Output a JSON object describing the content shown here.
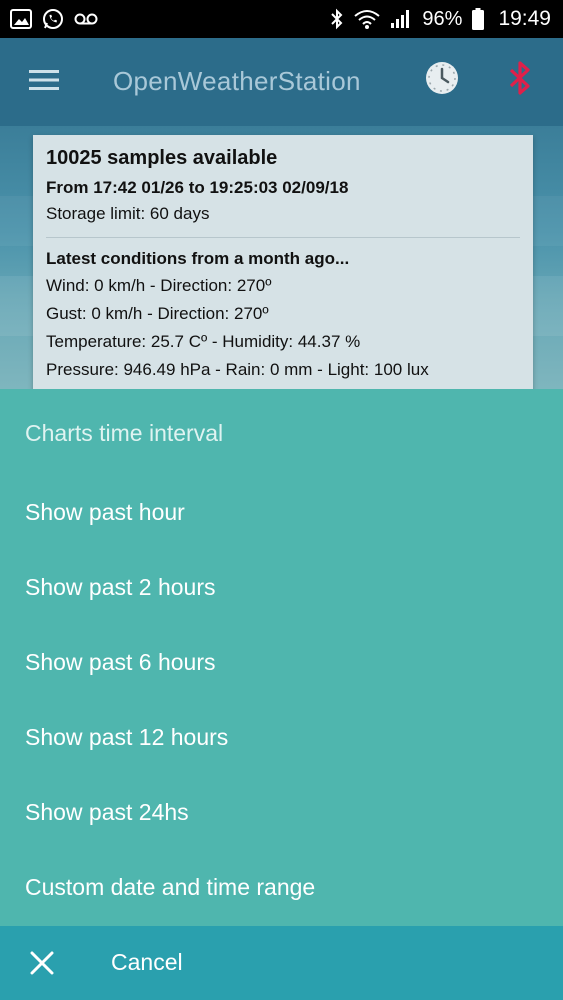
{
  "status_bar": {
    "battery_percent": "96%",
    "time": "19:49",
    "icons": [
      "image-icon",
      "whatsapp-icon",
      "voicemail-icon",
      "bluetooth-icon",
      "wifi-icon",
      "signal-icon",
      "battery-icon"
    ]
  },
  "app_bar": {
    "title": "OpenWeatherStation",
    "icons": [
      "menu-icon",
      "clock-icon",
      "bluetooth-icon"
    ],
    "colors": {
      "bluetooth": "#e0204a",
      "background": "#2c6c8a"
    }
  },
  "info_card": {
    "samples": "10025 samples available",
    "range": "From 17:42 01/26 to 19:25:03 02/09/18",
    "storage": "Storage limit: 60 days",
    "latest_header": "Latest conditions from a month ago...",
    "wind": "Wind: 0 km/h - Direction: 270º",
    "gust": "Gust: 0 km/h - Direction: 270º",
    "temp_humidity": "Temperature: 25.7 Cº - Humidity: 44.37 %",
    "pressure_rain_light": "Pressure: 946.49 hPa - Rain: 0 mm - Light: 100 lux"
  },
  "sheet": {
    "title": "Charts time interval",
    "options": [
      {
        "label": "Show past hour"
      },
      {
        "label": "Show past 2 hours"
      },
      {
        "label": "Show past 6 hours"
      },
      {
        "label": "Show past 12 hours"
      },
      {
        "label": "Show past 24hs"
      },
      {
        "label": "Custom date and time range"
      }
    ],
    "cancel_label": "Cancel",
    "colors": {
      "sheet": "#4fb6ae",
      "cancel_bar": "#2aa0ae"
    }
  }
}
